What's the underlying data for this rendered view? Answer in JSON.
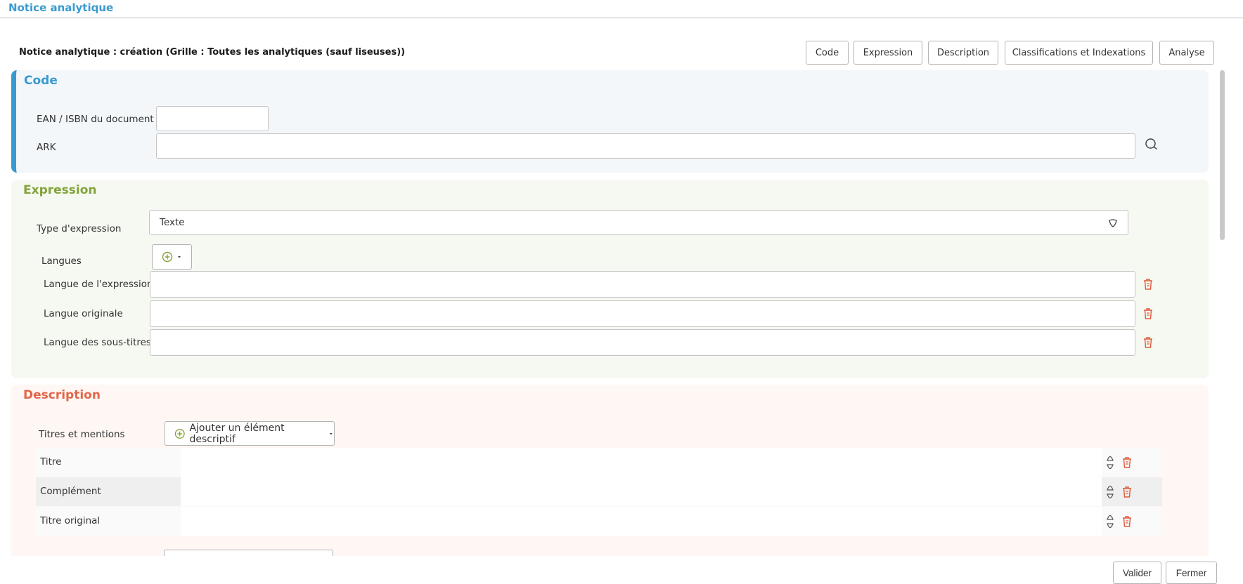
{
  "page": {
    "title": "Notice analytique",
    "form_title": "Notice analytique : création (Grille : Toutes les analytiques (sauf liseuses))"
  },
  "nav_buttons": [
    "Code",
    "Expression",
    "Description",
    "Classifications et Indexations",
    "Analyse"
  ],
  "colors": {
    "accent_blue": "#3a9ad0",
    "accent_green": "#84a33a",
    "accent_orange": "#e0674a",
    "delete_red": "#e05a3a"
  },
  "code_section": {
    "title": "Code",
    "ean_label": "EAN / ISBN du document",
    "ean_value": "",
    "ark_label": "ARK",
    "ark_value": "",
    "search_icon": "search-icon"
  },
  "expression_section": {
    "title": "Expression",
    "type_label": "Type d'expression",
    "type_value": "Texte",
    "langues_label": "Langues",
    "languages": [
      {
        "label": "Langue de l'expression",
        "value": ""
      },
      {
        "label": "Langue originale",
        "value": ""
      },
      {
        "label": "Langue des sous-titres",
        "value": ""
      }
    ]
  },
  "description_section": {
    "title": "Description",
    "titres_label": "Titres et mentions",
    "add_button_label": "Ajouter un élément descriptif",
    "rows": [
      {
        "label": "Titre",
        "value": ""
      },
      {
        "label": "Complément",
        "value": ""
      },
      {
        "label": "Titre original",
        "value": ""
      }
    ]
  },
  "footer": {
    "validate_label": "Valider",
    "close_label": "Fermer"
  }
}
